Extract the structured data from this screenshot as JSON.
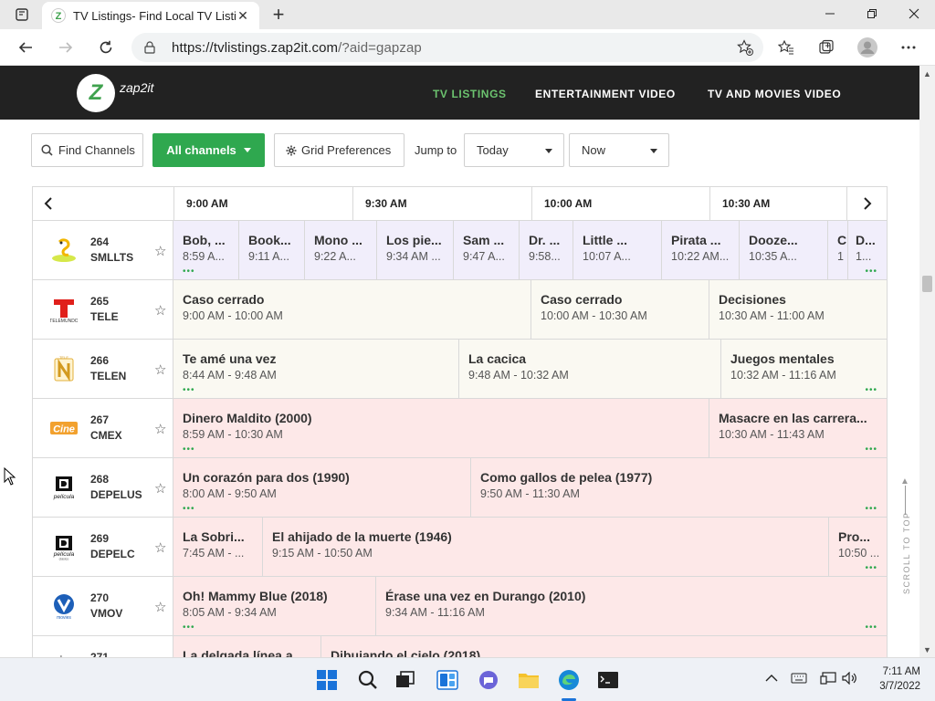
{
  "browser": {
    "tab_title": "TV Listings- Find Local TV Listings",
    "url_host": "https://tvlistings.zap2it.com",
    "url_path": "/?aid=gapzap"
  },
  "site": {
    "logo_text": "zap2it",
    "logo_letter": "Z",
    "nav": [
      "TV LISTINGS",
      "ENTERTAINMENT VIDEO",
      "TV AND MOVIES VIDEO"
    ],
    "active_color": "#6cc36f"
  },
  "controls": {
    "find_channels": "Find Channels",
    "all_channels": "All channels",
    "grid_preferences": "Grid Preferences",
    "jump_to": "Jump to",
    "day": "Today",
    "time": "Now"
  },
  "time_slots": [
    "9:00 AM",
    "9:30 AM",
    "10:00 AM",
    "10:30 AM"
  ],
  "channels": [
    {
      "number": "264",
      "call": "SMLLTS",
      "logo": "smllts-logo",
      "genre": "kids",
      "programs": [
        {
          "title": "Bob, ...",
          "time": "8:59 A..."
        },
        {
          "title": "Book...",
          "time": "9:11 A..."
        },
        {
          "title": "Mono ...",
          "time": "9:22 A..."
        },
        {
          "title": "Los pie...",
          "time": "9:34 AM ..."
        },
        {
          "title": "Sam ...",
          "time": "9:47 A..."
        },
        {
          "title": "Dr. ...",
          "time": "9:58..."
        },
        {
          "title": "Little ...",
          "time": "10:07 A..."
        },
        {
          "title": "Pirata ...",
          "time": "10:22 AM..."
        },
        {
          "title": "Dooze...",
          "time": "10:35 A..."
        },
        {
          "title": "C",
          "time": "1"
        },
        {
          "title": "D...",
          "time": "1..."
        }
      ]
    },
    {
      "number": "265",
      "call": "TELE",
      "logo": "telemundo-logo",
      "genre": "general",
      "programs": [
        {
          "title": "Caso cerrado",
          "time": "9:00 AM - 10:00 AM"
        },
        {
          "title": "Caso cerrado",
          "time": "10:00 AM - 10:30 AM"
        },
        {
          "title": "Decisiones",
          "time": "10:30 AM - 11:00 AM"
        }
      ]
    },
    {
      "number": "266",
      "call": "TELEN",
      "logo": "telenovelas-logo",
      "genre": "general",
      "programs": [
        {
          "title": "Te amé una vez",
          "time": "8:44 AM - 9:48 AM"
        },
        {
          "title": "La cacica",
          "time": "9:48 AM - 10:32 AM"
        },
        {
          "title": "Juegos mentales",
          "time": "10:32 AM - 11:16 AM"
        }
      ]
    },
    {
      "number": "267",
      "call": "CMEX",
      "logo": "cine-mexicano-logo",
      "genre": "movie",
      "programs": [
        {
          "title": "Dinero Maldito (2000)",
          "time": "8:59 AM - 10:30 AM"
        },
        {
          "title": "Masacre en las carrera...",
          "time": "10:30 AM - 11:43 AM"
        }
      ]
    },
    {
      "number": "268",
      "call": "DEPELUS",
      "logo": "de-pelicula-logo",
      "genre": "movie",
      "programs": [
        {
          "title": "Un corazón para dos (1990)",
          "time": "8:00 AM - 9:50 AM"
        },
        {
          "title": "Como gallos de pelea (1977)",
          "time": "9:50 AM - 11:30 AM"
        }
      ]
    },
    {
      "number": "269",
      "call": "DEPELC",
      "logo": "de-pelicula-clasico-logo",
      "genre": "movie",
      "programs": [
        {
          "title": "La Sobri...",
          "time": "7:45 AM - ..."
        },
        {
          "title": "El ahijado de la muerte (1946)",
          "time": "9:15 AM - 10:50 AM"
        },
        {
          "title": "Pro...",
          "time": "10:50 ..."
        }
      ]
    },
    {
      "number": "270",
      "call": "VMOV",
      "logo": "vmov-logo",
      "genre": "movie",
      "programs": [
        {
          "title": "Oh! Mammy Blue (2018)",
          "time": "8:05 AM - 9:34 AM"
        },
        {
          "title": "Érase una vez en Durango (2010)",
          "time": "9:34 AM - 11:16 AM"
        }
      ]
    },
    {
      "number": "271",
      "call": "",
      "logo": "cine-logo",
      "genre": "movie",
      "programs": [
        {
          "title": "La delgada línea a",
          "time": ""
        },
        {
          "title": "Dibujando el cielo (2018)",
          "time": ""
        }
      ]
    }
  ],
  "scroll_to_top": "SCROLL TO TOP",
  "taskbar": {
    "time": "7:11 AM",
    "date": "3/7/2022"
  }
}
